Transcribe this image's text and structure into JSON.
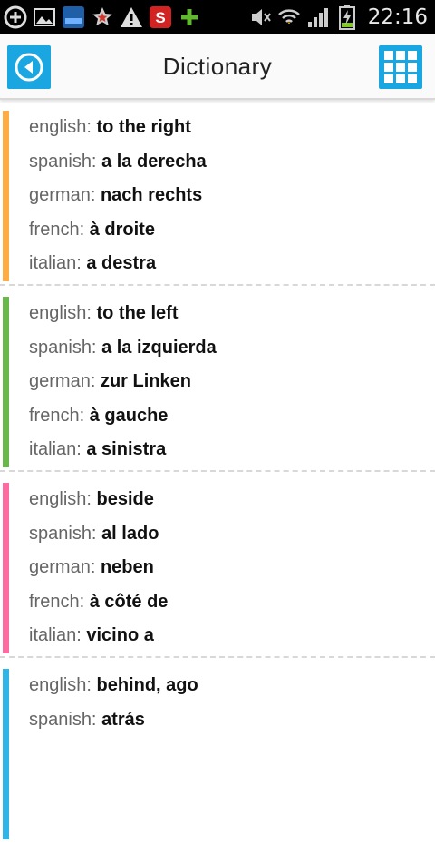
{
  "status_bar": {
    "time": "22:16",
    "left_icons": [
      "add-icon",
      "image-icon",
      "app-icon",
      "star-icon",
      "warning-icon",
      "s-app-icon",
      "plus-icon"
    ],
    "right_icons": [
      "mute-icon",
      "wifi-icon",
      "signal-icon",
      "battery-icon"
    ]
  },
  "header": {
    "title": "Dictionary",
    "back_icon": "back-arrow-icon",
    "menu_icon": "grid-icon",
    "accent": "#1aa6e0"
  },
  "entries": [
    {
      "color": "#ffad42",
      "translations": [
        {
          "lang": "english:",
          "word": "to the right"
        },
        {
          "lang": "spanish:",
          "word": "a la derecha"
        },
        {
          "lang": "german:",
          "word": "nach rechts"
        },
        {
          "lang": "french:",
          "word": "à droite"
        },
        {
          "lang": "italian:",
          "word": "a destra"
        }
      ]
    },
    {
      "color": "#69b84a",
      "translations": [
        {
          "lang": "english:",
          "word": "to the left"
        },
        {
          "lang": "spanish:",
          "word": "a la izquierda"
        },
        {
          "lang": "german:",
          "word": "zur Linken"
        },
        {
          "lang": "french:",
          "word": "à gauche"
        },
        {
          "lang": "italian:",
          "word": "a sinistra"
        }
      ]
    },
    {
      "color": "#ff6ba0",
      "translations": [
        {
          "lang": "english:",
          "word": "beside"
        },
        {
          "lang": "spanish:",
          "word": "al lado"
        },
        {
          "lang": "german:",
          "word": "neben"
        },
        {
          "lang": "french:",
          "word": "à côté de"
        },
        {
          "lang": "italian:",
          "word": "vicino a"
        }
      ]
    },
    {
      "color": "#2fb5e8",
      "translations": [
        {
          "lang": "english:",
          "word": "behind, ago"
        },
        {
          "lang": "spanish:",
          "word": "atrás"
        }
      ]
    }
  ]
}
